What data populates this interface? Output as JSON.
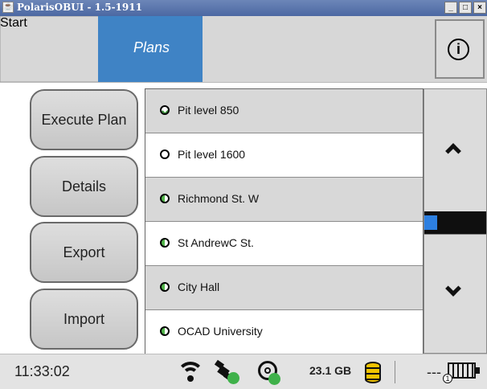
{
  "window": {
    "title": "PolarisOBUI - 1.5-1911",
    "app_icon": "java-icon",
    "controls": [
      "_",
      "□",
      "×"
    ]
  },
  "breadcrumb": {
    "items": [
      "Start",
      "Plans"
    ],
    "active": "Plans"
  },
  "header": {
    "info_icon": "info-icon",
    "info_glyph": "i"
  },
  "actions": [
    {
      "label": "Execute Plan"
    },
    {
      "label": "Details"
    },
    {
      "label": "Export"
    },
    {
      "label": "Import"
    }
  ],
  "plans": [
    {
      "label": "Pit level 850",
      "status": "check"
    },
    {
      "label": "Pit level 1600",
      "status": "open"
    },
    {
      "label": "Richmond St. W",
      "status": "half"
    },
    {
      "label": "St AndrewC St.",
      "status": "half"
    },
    {
      "label": "City Hall",
      "status": "half"
    },
    {
      "label": "OCAD University",
      "status": "half"
    }
  ],
  "status": {
    "time": "11:33:02",
    "storage": "23.1 GB",
    "wifi_icon": "wifi-icon",
    "gps_icon": "satellite-icon",
    "disc_icon": "disc-icon",
    "database_icon": "database-icon",
    "battery_icon": "battery-icon",
    "right_text": "---",
    "battery_badge": "1"
  },
  "colors": {
    "titlebar": "#5a76ad",
    "breadcrumb_active": "#3f83c5",
    "scroll_thumb": "#2d7fe0",
    "ok_green": "#3fb14a",
    "storage_yellow": "#f2c400"
  }
}
